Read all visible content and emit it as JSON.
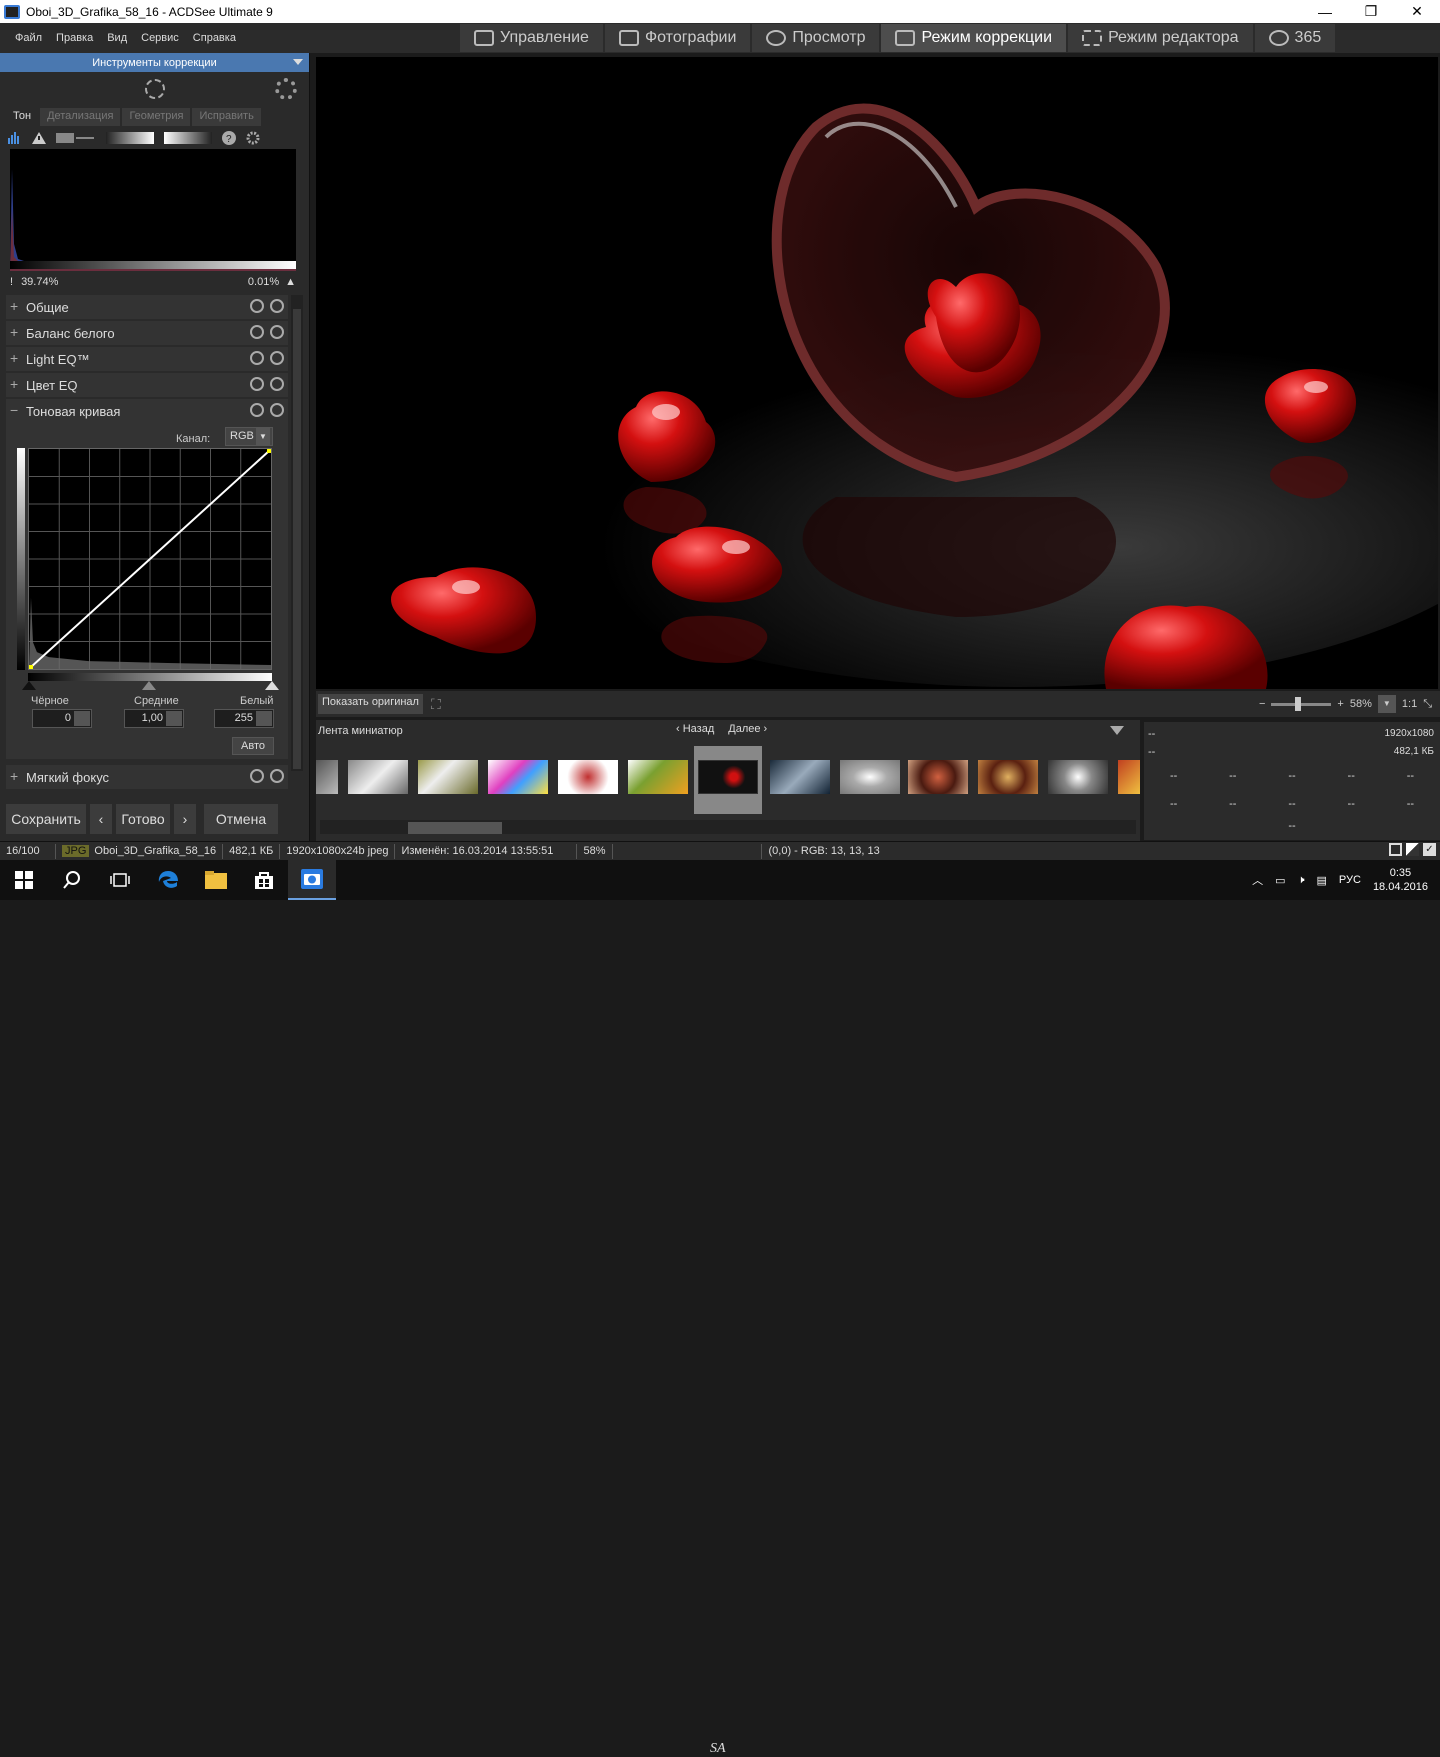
{
  "window": {
    "title": "Oboi_3D_Grafika_58_16 - ACDSee Ultimate 9",
    "buttons": {
      "minimize": "—",
      "maximize": "❐",
      "close": "✕"
    }
  },
  "menu": [
    "Файл",
    "Правка",
    "Вид",
    "Сервис",
    "Справка"
  ],
  "modes": [
    {
      "label": "Управление",
      "icon": "grid-icon"
    },
    {
      "label": "Фотографии",
      "icon": "photos-icon"
    },
    {
      "label": "Просмотр",
      "icon": "eye-icon"
    },
    {
      "label": "Режим коррекции",
      "icon": "develop-icon",
      "active": true
    },
    {
      "label": "Режим редактора",
      "icon": "edit-tools-icon"
    },
    {
      "label": "365",
      "icon": "cloud-365-icon"
    }
  ],
  "panel": {
    "header": "Инструменты коррекции",
    "tabs": [
      "Тон",
      "Детализация",
      "Геометрия",
      "Исправить"
    ],
    "histogram": {
      "left_pct": "39.74%",
      "right_pct": "0.01%"
    },
    "sections": [
      "Общие",
      "Баланс белого",
      "Light EQ™",
      "Цвет EQ"
    ],
    "tone_curve": {
      "title": "Тоновая кривая",
      "channel_label": "Канал:",
      "channel_value": "RGB",
      "black_label": "Чёрное",
      "mid_label": "Средние",
      "white_label": "Белый",
      "black_value": "0",
      "mid_value": "1,00",
      "white_value": "255",
      "auto_label": "Авто"
    },
    "soft_focus": "Мягкий фокус",
    "buttons": {
      "save": "Сохранить",
      "prev": "‹",
      "done": "Готово",
      "next": "›",
      "cancel": "Отмена"
    }
  },
  "viewer": {
    "show_original": "Показать оригинал",
    "zoom_value": "58%",
    "zoom_ratio": "1:1"
  },
  "filmstrip": {
    "title": "Лента миниатюр",
    "back": "Назад",
    "forward": "Далее",
    "selected_index": 6
  },
  "info": {
    "resolution": "1920x1080",
    "size": "482,1 КБ",
    "dash": "--"
  },
  "status": {
    "counter": "16/100",
    "format": "JPG",
    "filename": "Oboi_3D_Grafika_58_16",
    "filesize": "482,1 КБ",
    "dims": "1920x1080x24b jpeg",
    "modified": "Изменён: 16.03.2014 13:55:51",
    "zoom": "58%",
    "pixel": "(0,0) - RGB: 13, 13, 13"
  },
  "taskbar": {
    "lang": "РУС",
    "time": "0:35",
    "date": "18.04.2016",
    "center_text": "SA"
  },
  "colors": {
    "accent": "#4a78b0",
    "heart": "#d01010"
  }
}
